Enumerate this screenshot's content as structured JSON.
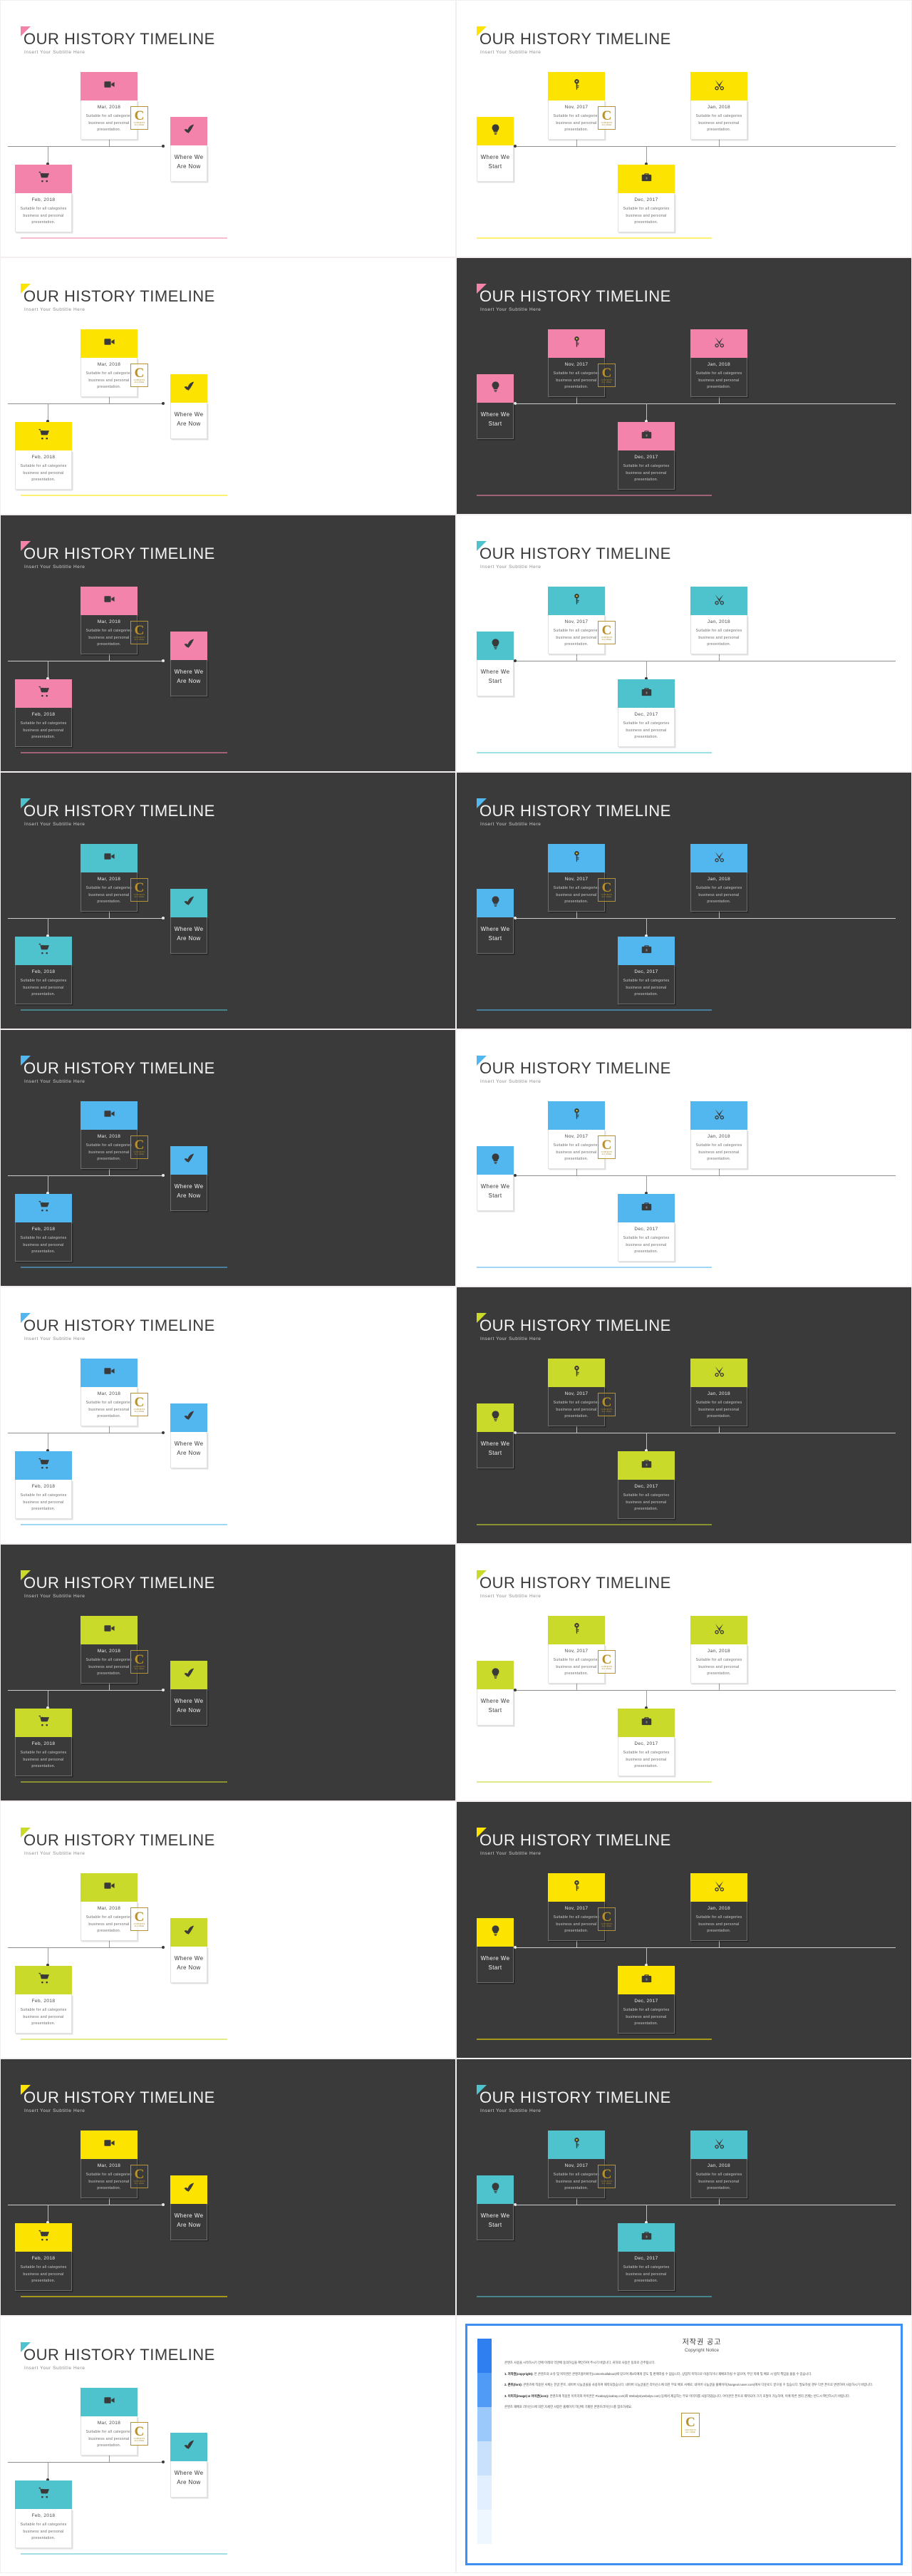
{
  "meta": {
    "title": "OUR HISTORY TIMELINE",
    "subtitle": "Insert Your Subtitle Here"
  },
  "strings": {
    "desc_line1": "Suitable for all categories",
    "desc_line2": "business and personal",
    "desc_line3": "presentation.",
    "where_we_are_now_l1": "Where We",
    "where_we_are_now_l2": "Are Now",
    "where_we_start_l1": "Where We",
    "where_we_start_l2": "Start",
    "date_mar": "Mar, 2018",
    "date_feb": "Feb, 2018",
    "date_nov": "Nov, 2017",
    "date_dec": "Dec, 2017",
    "date_jan": "Jan, 2018"
  },
  "icons": {
    "video": "video-camera-icon",
    "cart": "shopping-cart-icon",
    "leaf": "leaf-check-icon",
    "bulb": "lightbulb-icon",
    "key": "key-icon",
    "briefcase": "briefcase-icon",
    "scissors": "scissors-icon"
  },
  "watermark": {
    "letter": "C",
    "caption": "CONTENTS",
    "sub": "ALL FREE"
  },
  "colors": {
    "pink": "#f383ab",
    "yellow": "#fce300",
    "teal": "#4ec3ce",
    "blue": "#52b7ef",
    "lime": "#cada2a",
    "dark_bg": "#3b3a3a",
    "light_bg": "#ffffff",
    "copyright_border": "#3d8ff5"
  },
  "slides": [
    {
      "n": 1,
      "layout": "A",
      "theme": "light",
      "accent": "#f383ab"
    },
    {
      "n": 2,
      "layout": "B",
      "theme": "light",
      "accent": "#fce300"
    },
    {
      "n": 3,
      "layout": "A",
      "theme": "light",
      "accent": "#fce300"
    },
    {
      "n": 4,
      "layout": "B",
      "theme": "dark",
      "accent": "#f383ab"
    },
    {
      "n": 5,
      "layout": "A",
      "theme": "dark",
      "accent": "#f383ab"
    },
    {
      "n": 6,
      "layout": "B",
      "theme": "light",
      "accent": "#4ec3ce"
    },
    {
      "n": 7,
      "layout": "A",
      "theme": "dark",
      "accent": "#4ec3ce"
    },
    {
      "n": 8,
      "layout": "B",
      "theme": "dark",
      "accent": "#52b7ef"
    },
    {
      "n": 9,
      "layout": "A",
      "theme": "dark",
      "accent": "#52b7ef"
    },
    {
      "n": 10,
      "layout": "B",
      "theme": "light",
      "accent": "#52b7ef"
    },
    {
      "n": 11,
      "layout": "A",
      "theme": "light",
      "accent": "#52b7ef"
    },
    {
      "n": 12,
      "layout": "B",
      "theme": "dark",
      "accent": "#cada2a"
    },
    {
      "n": 13,
      "layout": "A",
      "theme": "dark",
      "accent": "#cada2a"
    },
    {
      "n": 14,
      "layout": "B",
      "theme": "light",
      "accent": "#cada2a"
    },
    {
      "n": 15,
      "layout": "A",
      "theme": "light",
      "accent": "#cada2a"
    },
    {
      "n": 16,
      "layout": "B",
      "theme": "dark",
      "accent": "#fce300"
    },
    {
      "n": 17,
      "layout": "A",
      "theme": "dark",
      "accent": "#fce300"
    },
    {
      "n": 18,
      "layout": "B",
      "theme": "dark",
      "accent": "#4ec3ce"
    },
    {
      "n": 19,
      "layout": "A",
      "theme": "light",
      "accent": "#4ec3ce"
    }
  ],
  "copyright": {
    "title_ko": "저작권 공고",
    "title_en": "Copyright Notice",
    "intro": "콘텐츠 사용을 시작하시기 전에 아래의 약관에 동의하심을 확인하여 주시기 바랍니다. 귀하의 사용은 동의로 간주됩니다.",
    "sections": [
      {
        "head": "1. 저작권(copyright):",
        "text": "본 콘텐츠의 소유 및 저작권은 콘텐츠올어바웃(contentsallabout)에 있으며 제3자에게 양도 및 판매하실 수 없습니다. 상업적 목적으로 이용하거나 재배포하실 수 없으며, 무단 복제 및 배포 시 법적 책임을 물을 수 있습니다."
      },
      {
        "head": "2. 폰트(font):",
        "text": "콘텐츠에 적용된 서체는 한글 폰트, 네이버 나눔글꼴을 사용하여 제작되었습니다. 네이버 나눔글꼴은 라이선스에 의한 무료 배포 서체로, 네이버 나눔글꼴 홈페이지(hangeul.naver.com)에서 다운로드 받으실 수 있습니다. 필요하실 경우 다른 폰트로 변경하여 사용하시기 바랍니다."
      },
      {
        "head": "3. 이미지(image) & 아이콘(icon):",
        "text": "콘텐츠에 적용된 이미지와 아이콘은 Pixabay(pixabay.com)와 Webalys(webalys.com) 등에서 제공하는 무료 이미지를 사용하였습니다. 아이콘은 폰트로 제작되어 크기 조절이 가능하며, 이에 따른 권리 관계는 반드시 확인하시기 바랍니다."
      }
    ],
    "outro": "콘텐츠 재배포 라이선스에 의한 자세한 사항은 홈페이지 하단에 기재된 콘텐츠라이선스를 참조하세요."
  }
}
